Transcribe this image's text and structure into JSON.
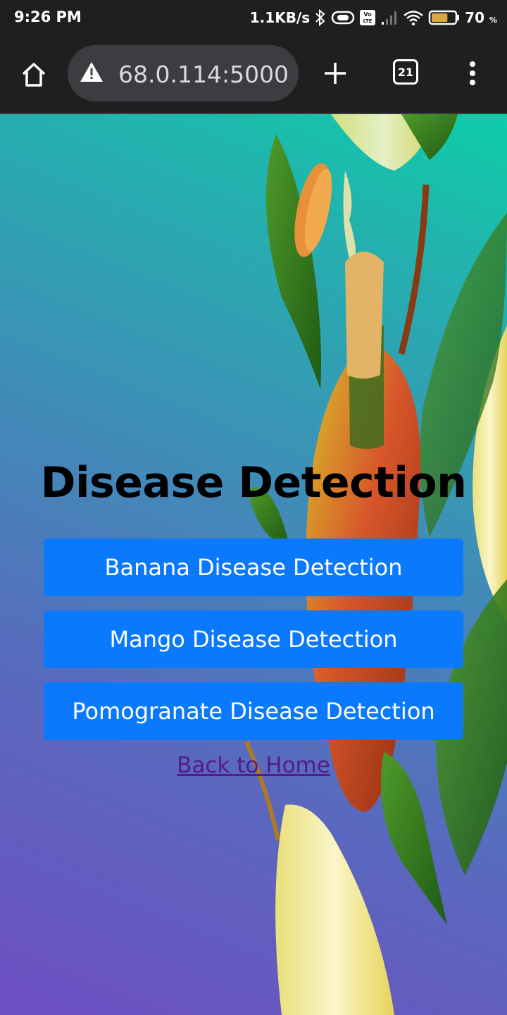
{
  "status_bar": {
    "time": "9:26 PM",
    "net_speed": "1.1KB/s",
    "battery_percent": "70",
    "battery_unit": "%",
    "battery_level": 0.7,
    "icons": [
      "bluetooth-icon",
      "vibrate-icon",
      "volte-icon",
      "signal-icon",
      "wifi-icon",
      "battery-icon"
    ]
  },
  "browser": {
    "url": "68.0.114:5000",
    "tab_count": "21",
    "icons": [
      "home-icon",
      "warning-icon",
      "plus-icon",
      "tab-switcher-icon",
      "overflow-menu-icon"
    ]
  },
  "page": {
    "title": "Disease Detection",
    "buttons": {
      "banana": "Banana Disease Detection",
      "mango": "Mango Disease Detection",
      "pomegranate": "Pomogranate Disease Detection"
    },
    "back_link": "Back to Home"
  },
  "colors": {
    "button_bg": "#0a79fb",
    "link": "#551a8b",
    "chrome_bg": "#1f1f1f",
    "url_bar_bg": "#3b3d40"
  }
}
